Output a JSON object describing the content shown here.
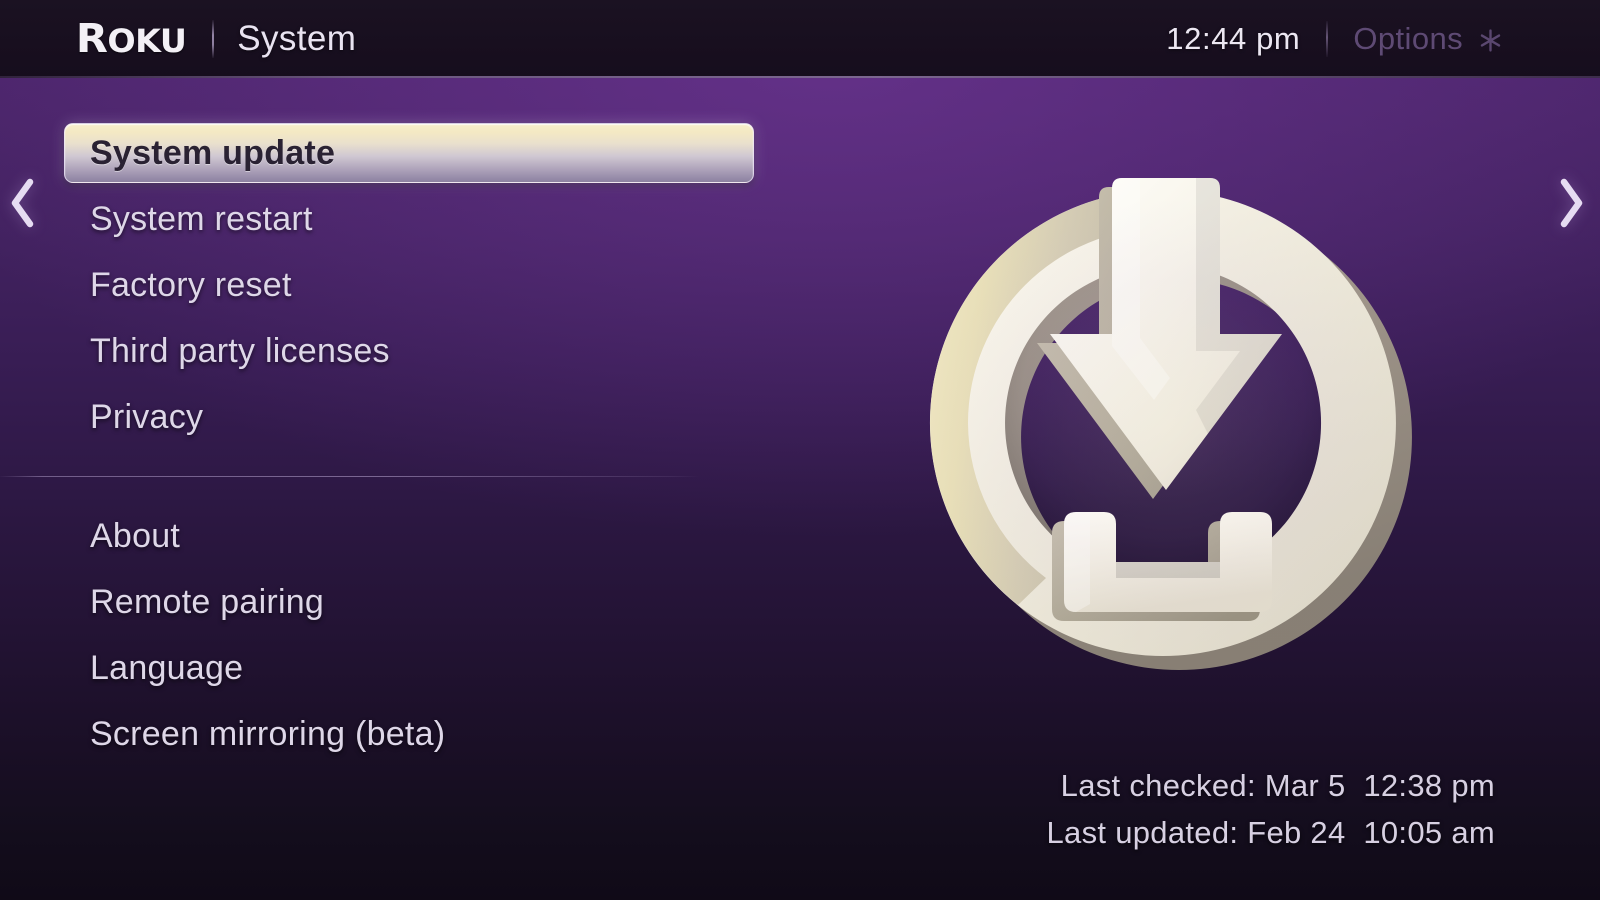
{
  "header": {
    "brand": "Roku",
    "brand_cap": "R",
    "brand_rest": "OKU",
    "section_title": "System",
    "time": "12:44 pm",
    "options_label": "Options",
    "options_icon": "asterisk-icon"
  },
  "nav": {
    "left_chevron": "chevron-left-icon",
    "right_chevron": "chevron-right-icon"
  },
  "menu": {
    "group_one": [
      {
        "label": "System update",
        "selected": true
      },
      {
        "label": "System restart",
        "selected": false
      },
      {
        "label": "Factory reset",
        "selected": false
      },
      {
        "label": "Third party licenses",
        "selected": false
      },
      {
        "label": "Privacy",
        "selected": false
      }
    ],
    "group_two": [
      {
        "label": "About",
        "selected": false
      },
      {
        "label": "Remote pairing",
        "selected": false
      },
      {
        "label": "Language",
        "selected": false
      },
      {
        "label": "Screen mirroring (beta)",
        "selected": false
      }
    ]
  },
  "panel": {
    "icon_name": "software-update-download-icon",
    "last_checked": "Last checked: Mar 5  12:38 pm",
    "last_updated": "Last updated: Feb 24  10:05 am"
  },
  "colors": {
    "background_top": "#4e2670",
    "background_bottom": "#100a17",
    "header_bg": "#180f1f",
    "highlight_top": "#f7eecb",
    "highlight_bottom": "#8d82a0",
    "menu_text": "#ded7e8",
    "selected_text": "#2a2233",
    "options_text": "#5e4a74",
    "icon_fill": "#f2efe6"
  }
}
